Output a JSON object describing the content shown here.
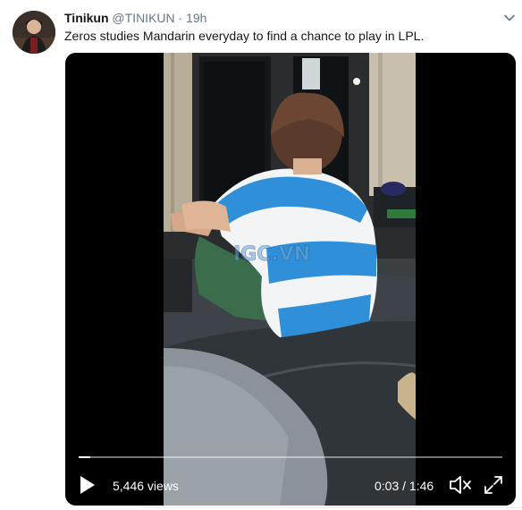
{
  "tweet": {
    "author_name": "Tinikun",
    "author_handle": "@TINIKUN",
    "separator": "·",
    "timestamp": "19h",
    "text": "Zeros studies Mandarin everyday to find a chance to play in LPL."
  },
  "video": {
    "views": "5,446 views",
    "time_current": "0:03",
    "time_separator": "/",
    "time_total": "1:46",
    "progress_fraction": 0.028,
    "watermark": "IGC.VN"
  },
  "icons": {
    "caret": "chevron-down-icon",
    "play": "play-icon",
    "mute": "volume-muted-icon",
    "fullscreen": "fullscreen-icon"
  },
  "colors": {
    "name": "#14171a",
    "secondary": "#657786",
    "video_bg": "#000000",
    "shirt_blue": "#2f8fd8"
  }
}
